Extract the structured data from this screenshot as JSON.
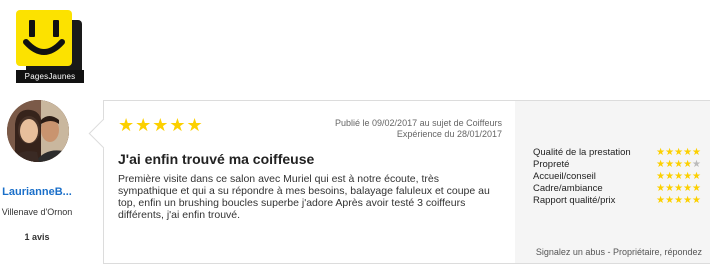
{
  "brand": {
    "logo_text": "PagesJaunes"
  },
  "user": {
    "name": "LaurianneB...",
    "city": "Villenave d'Ornon",
    "count": "1 avis"
  },
  "review": {
    "rating": 5,
    "published": "Publié le 09/02/2017",
    "subject": "au sujet de Coiffeurs",
    "experience": "Expérience du 28/01/2017",
    "title": "J'ai enfin trouvé ma coiffeuse",
    "body": "Première visite dans ce salon avec Muriel qui est à notre écoute, très sympathique et qui a su répondre à mes besoins, balayage faluleux et coupe au top, enfin un brushing boucles superbe j'adore Après avoir testé 3 coiffeurs différents, j'ai enfin trouvé."
  },
  "criteria": [
    {
      "label": "Qualité de la prestation",
      "rating": 5
    },
    {
      "label": "Propreté",
      "rating": 4
    },
    {
      "label": "Accueil/conseil",
      "rating": 5
    },
    {
      "label": "Cadre/ambiance",
      "rating": 5
    },
    {
      "label": "Rapport qualité/prix",
      "rating": 5
    }
  ],
  "footer": {
    "report_link": "Signalez un abus - Propriétaire, répondez"
  }
}
